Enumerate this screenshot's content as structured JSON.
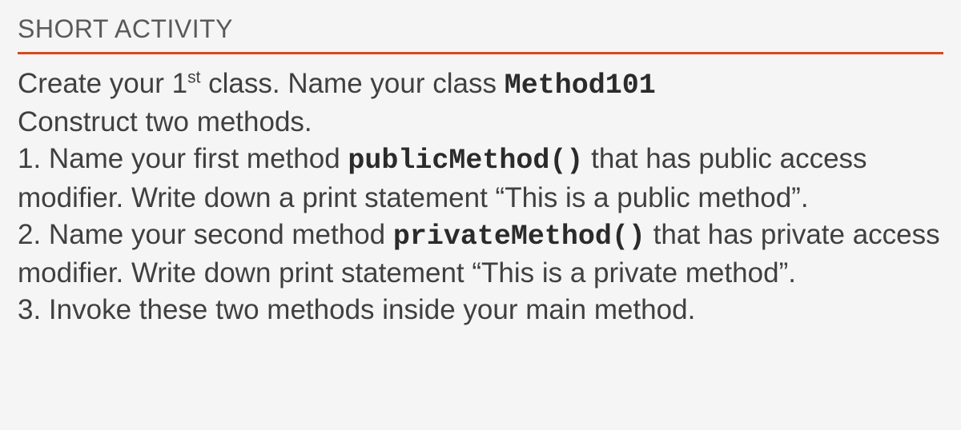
{
  "heading": "SHORT ACTIVITY",
  "intro": {
    "part1": "Create your 1",
    "sup": "st",
    "part2": " class. Name your class ",
    "code": "Method101"
  },
  "construct": "Construct two methods.",
  "item1": {
    "prefix": "1. Name your first method ",
    "code": "publicMethod()",
    "suffix": " that has public access modifier. Write down a print statement “This is a public method”."
  },
  "item2": {
    "prefix": "2. Name your second method ",
    "code": "privateMethod()",
    "suffix": "  that has private access modifier. Write down print statement “This is a private method”."
  },
  "item3": "3. Invoke these two methods inside your main method."
}
